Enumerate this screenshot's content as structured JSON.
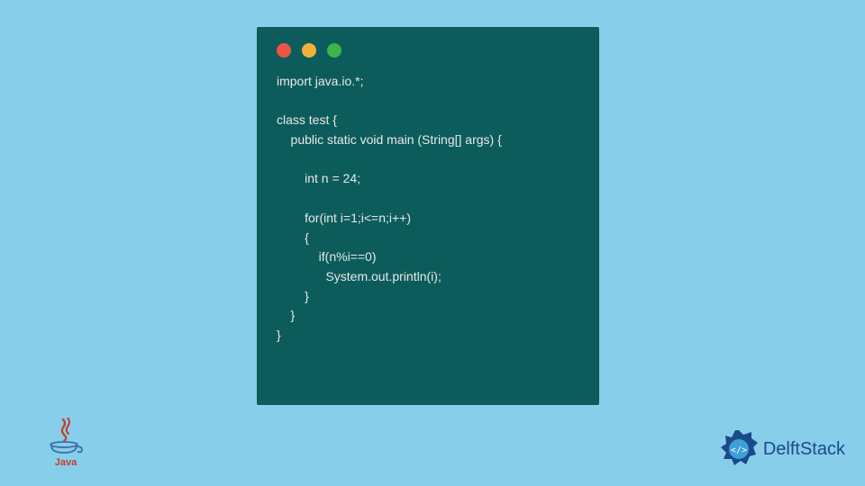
{
  "code": {
    "lines": [
      "import java.io.*;",
      "",
      "class test {",
      "    public static void main (String[] args) {",
      "",
      "        int n = 24;",
      "",
      "        for(int i=1;i<=n;i++)",
      "        {",
      "            if(n%i==0)",
      "              System.out.println(i);",
      "        }",
      "    }",
      "}"
    ]
  },
  "logos": {
    "java_label": "Java",
    "delft_label": "DelftStack"
  },
  "colors": {
    "background": "#87CEEB",
    "window": "#0d5c5c",
    "text": "#e8e8e8",
    "java_red": "#c73a2b",
    "delft_blue": "#1a4a8a"
  }
}
